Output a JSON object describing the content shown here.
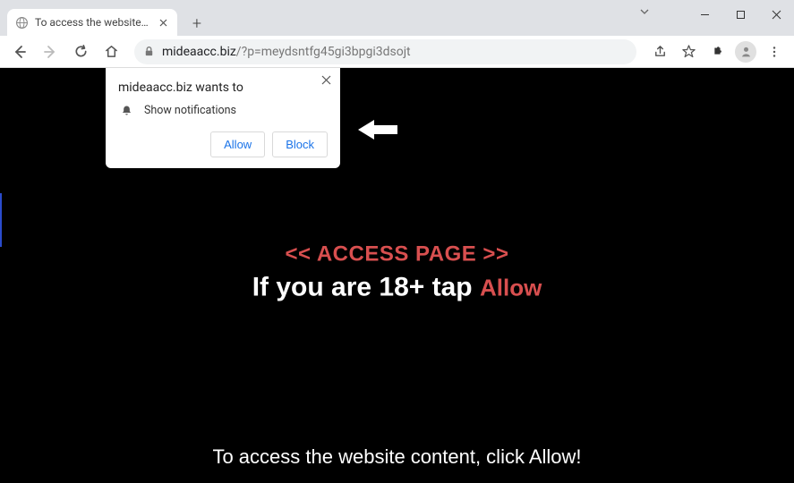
{
  "window": {
    "tab_title": "To access the website content, cli"
  },
  "toolbar": {
    "url_domain": "mideaacc.biz",
    "url_path": "/?p=meydsntfg45gi3bpgi3dsojt"
  },
  "permission_prompt": {
    "title": "mideaacc.biz wants to",
    "row_label": "Show notifications",
    "allow_label": "Allow",
    "block_label": "Block"
  },
  "page": {
    "access_line": "<< ACCESS PAGE >>",
    "age_line_prefix": "If you are 18+ tap ",
    "age_line_allow": "Allow",
    "footer": "To access the website content, click Allow!"
  }
}
